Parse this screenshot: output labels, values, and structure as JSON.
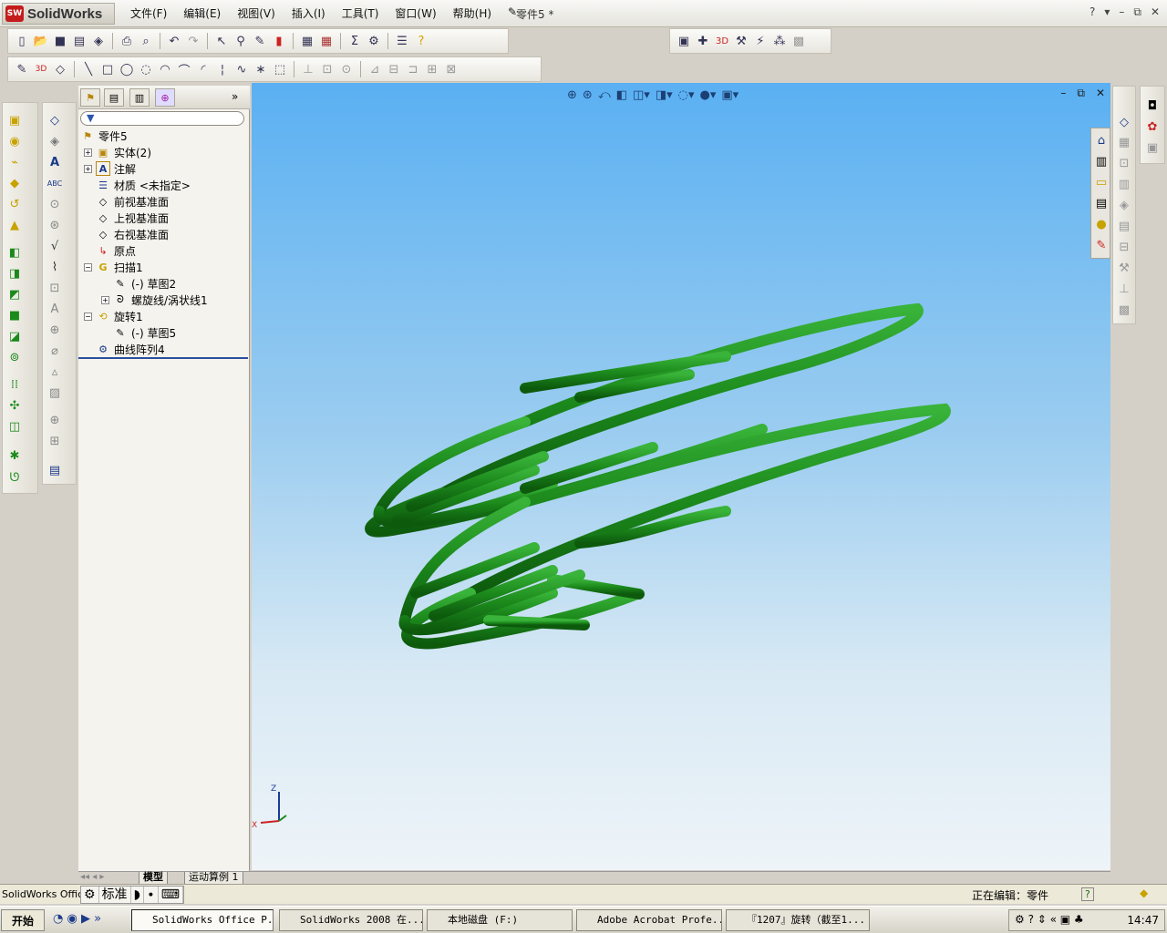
{
  "app": {
    "brand": "SolidWorks",
    "doc_title": "零件5 *"
  },
  "menu": [
    "文件(F)",
    "编辑(E)",
    "视图(V)",
    "插入(I)",
    "工具(T)",
    "窗口(W)",
    "帮助(H)"
  ],
  "window_controls": [
    "?",
    "▾",
    "–",
    "⧉",
    "✕"
  ],
  "feature_tree": {
    "root": "零件5",
    "nodes": [
      {
        "label": "实体(2)",
        "icon": "solid-bodies-icon"
      },
      {
        "label": "注解",
        "icon": "annotations-icon"
      },
      {
        "label": "材质 <未指定>",
        "icon": "material-icon"
      },
      {
        "label": "前视基准面",
        "icon": "plane-icon"
      },
      {
        "label": "上视基准面",
        "icon": "plane-icon"
      },
      {
        "label": "右视基准面",
        "icon": "plane-icon"
      },
      {
        "label": "原点",
        "icon": "origin-icon"
      },
      {
        "label": "扫描1",
        "icon": "sweep-icon"
      },
      {
        "label": "(-) 草图2",
        "icon": "sketch-icon"
      },
      {
        "label": "螺旋线/涡状线1",
        "icon": "helix-icon"
      },
      {
        "label": "旋转1",
        "icon": "revolve-icon"
      },
      {
        "label": "(-) 草图5",
        "icon": "sketch-icon"
      },
      {
        "label": "曲线阵列4",
        "icon": "curve-pattern-icon"
      }
    ]
  },
  "bottom_tabs": {
    "model": "模型",
    "motion": "运动算例 1"
  },
  "status": {
    "left": "SolidWorks Office",
    "ime": [
      "标准"
    ],
    "editing": "正在编辑：零件",
    "help": "?"
  },
  "taskbar": {
    "start": "开始",
    "tasks": [
      "SolidWorks Office P...",
      "SolidWorks 2008 在...",
      "本地磁盘 (F:)",
      "Adobe Acrobat Profe...",
      "『1207』旋转（截至1..."
    ],
    "clock": "14:47"
  },
  "triad": {
    "z": "Z",
    "x": "X"
  },
  "colors": {
    "model": "#1f8a1f",
    "viewport_top": "#5ab0f2",
    "viewport_bottom": "#eef4f8"
  }
}
